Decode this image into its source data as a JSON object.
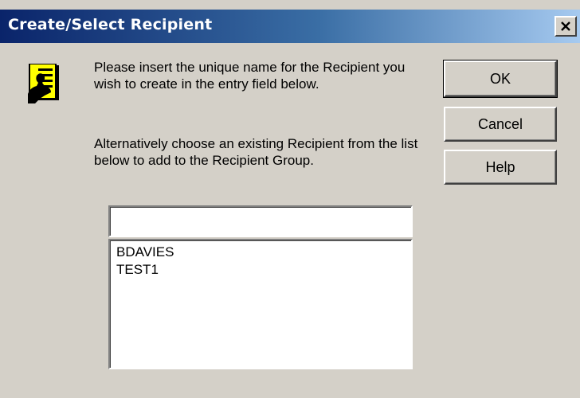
{
  "window": {
    "title": "Create/Select Recipient",
    "close_icon": "close-x-icon",
    "dialog_icon": "recipient-card-icon"
  },
  "message": {
    "line1": "Please insert the unique name for the Recipient you wish to create in the entry field below.",
    "line2": "Alternatively choose an existing Recipient from the list below to add to the Recipient Group."
  },
  "buttons": {
    "ok": "OK",
    "cancel": "Cancel",
    "help": "Help"
  },
  "name_input": {
    "value": "",
    "placeholder": ""
  },
  "recipients": {
    "items": [
      "BDAVIES",
      "TEST1"
    ]
  },
  "colors": {
    "title_bar_start": "#0a246a",
    "title_bar_end": "#a6caf0",
    "dialog_face": "#d4d0c8",
    "icon_yellow": "#ffff00"
  }
}
